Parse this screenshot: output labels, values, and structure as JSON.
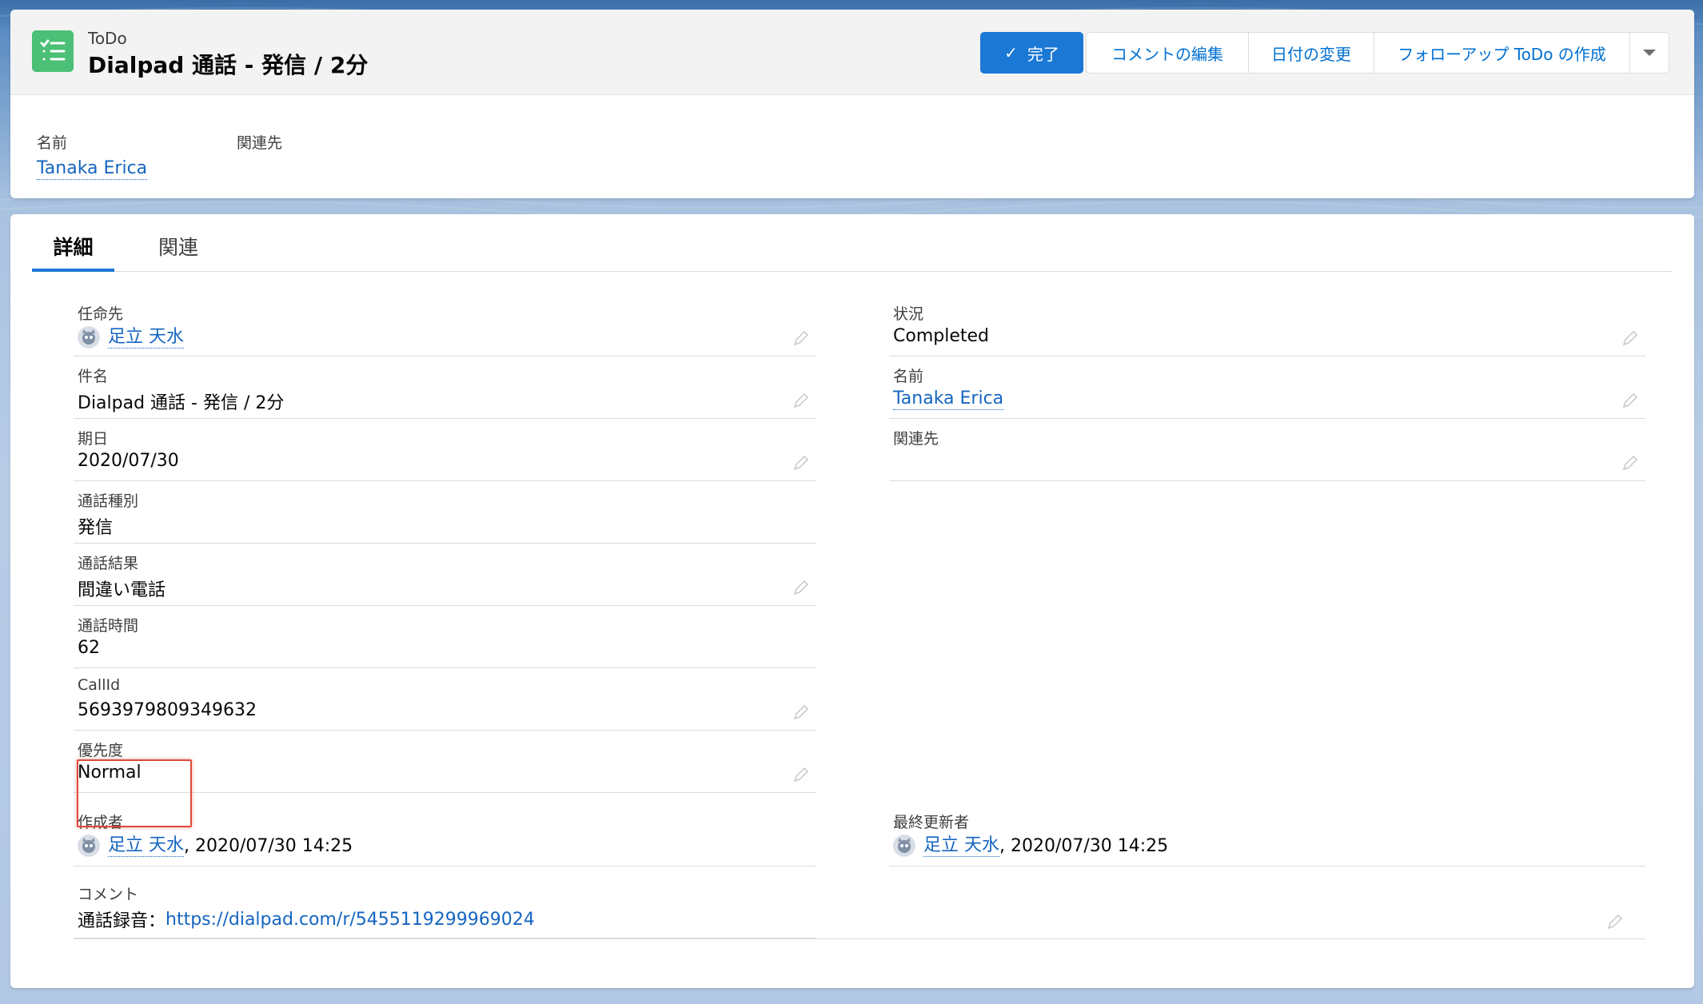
{
  "header": {
    "object_type": "ToDo",
    "title": "Dialpad 通話 - 発信 / 2分",
    "icon": "todo-list-icon",
    "icon_color": "#4bc076",
    "buttons": {
      "complete": "完了",
      "edit_comment": "コメントの編集",
      "change_date": "日付の変更",
      "follow_up": "フォローアップ ToDo の作成"
    },
    "fields": {
      "name_label": "名前",
      "name_value": "Tanaka Erica",
      "related_label": "関連先"
    }
  },
  "tabs": {
    "detail": "詳細",
    "related": "関連"
  },
  "fields": {
    "assignee": {
      "label": "任命先",
      "value": "足立 天水"
    },
    "subject": {
      "label": "件名",
      "value": "Dialpad 通話 - 発信 / 2分"
    },
    "due_date": {
      "label": "期日",
      "value": "2020/07/30"
    },
    "call_type": {
      "label": "通話種別",
      "value": "発信"
    },
    "call_result": {
      "label": "通話結果",
      "value": "間違い電話"
    },
    "call_duration": {
      "label": "通話時間",
      "value": "62"
    },
    "call_id": {
      "label": "CallId",
      "value": "5693979809349632"
    },
    "priority": {
      "label": "優先度",
      "value": "Normal"
    },
    "created_by": {
      "label": "作成者",
      "user": "足立 天水",
      "date": ", 2020/07/30 14:25"
    },
    "comment": {
      "label": "コメント",
      "prefix": "通話録音：",
      "link": "https://dialpad.com/r/5455119299969024"
    },
    "status": {
      "label": "状況",
      "value": "Completed"
    },
    "name": {
      "label": "名前",
      "value": "Tanaka Erica"
    },
    "related_to": {
      "label": "関連先",
      "value": ""
    },
    "last_modified_by": {
      "label": "最終更新者",
      "user": "足立 天水",
      "date": ", 2020/07/30 14:25"
    }
  },
  "colors": {
    "primary": "#1b78d5",
    "link": "#1565c0",
    "highlight": "#e04a3a"
  }
}
